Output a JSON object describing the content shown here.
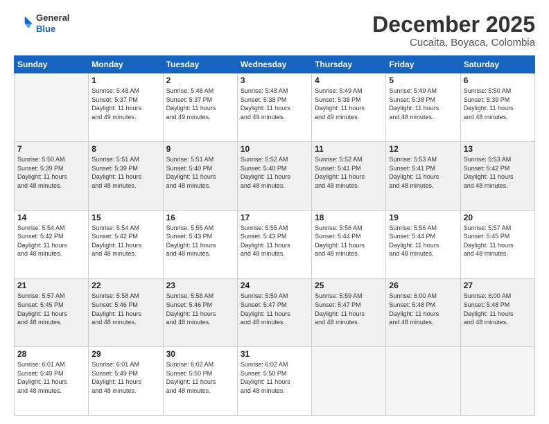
{
  "header": {
    "logo_line1": "General",
    "logo_line2": "Blue",
    "title": "December 2025",
    "subtitle": "Cucaita, Boyaca, Colombia"
  },
  "weekdays": [
    "Sunday",
    "Monday",
    "Tuesday",
    "Wednesday",
    "Thursday",
    "Friday",
    "Saturday"
  ],
  "weeks": [
    [
      {
        "day": "",
        "info": ""
      },
      {
        "day": "1",
        "info": "Sunrise: 5:48 AM\nSunset: 5:37 PM\nDaylight: 11 hours\nand 49 minutes."
      },
      {
        "day": "2",
        "info": "Sunrise: 5:48 AM\nSunset: 5:37 PM\nDaylight: 11 hours\nand 49 minutes."
      },
      {
        "day": "3",
        "info": "Sunrise: 5:48 AM\nSunset: 5:38 PM\nDaylight: 11 hours\nand 49 minutes."
      },
      {
        "day": "4",
        "info": "Sunrise: 5:49 AM\nSunset: 5:38 PM\nDaylight: 11 hours\nand 49 minutes."
      },
      {
        "day": "5",
        "info": "Sunrise: 5:49 AM\nSunset: 5:38 PM\nDaylight: 11 hours\nand 48 minutes."
      },
      {
        "day": "6",
        "info": "Sunrise: 5:50 AM\nSunset: 5:39 PM\nDaylight: 11 hours\nand 48 minutes."
      }
    ],
    [
      {
        "day": "7",
        "info": "Sunrise: 5:50 AM\nSunset: 5:39 PM\nDaylight: 11 hours\nand 48 minutes."
      },
      {
        "day": "8",
        "info": "Sunrise: 5:51 AM\nSunset: 5:39 PM\nDaylight: 11 hours\nand 48 minutes."
      },
      {
        "day": "9",
        "info": "Sunrise: 5:51 AM\nSunset: 5:40 PM\nDaylight: 11 hours\nand 48 minutes."
      },
      {
        "day": "10",
        "info": "Sunrise: 5:52 AM\nSunset: 5:40 PM\nDaylight: 11 hours\nand 48 minutes."
      },
      {
        "day": "11",
        "info": "Sunrise: 5:52 AM\nSunset: 5:41 PM\nDaylight: 11 hours\nand 48 minutes."
      },
      {
        "day": "12",
        "info": "Sunrise: 5:53 AM\nSunset: 5:41 PM\nDaylight: 11 hours\nand 48 minutes."
      },
      {
        "day": "13",
        "info": "Sunrise: 5:53 AM\nSunset: 5:42 PM\nDaylight: 11 hours\nand 48 minutes."
      }
    ],
    [
      {
        "day": "14",
        "info": "Sunrise: 5:54 AM\nSunset: 5:42 PM\nDaylight: 11 hours\nand 48 minutes."
      },
      {
        "day": "15",
        "info": "Sunrise: 5:54 AM\nSunset: 5:42 PM\nDaylight: 11 hours\nand 48 minutes."
      },
      {
        "day": "16",
        "info": "Sunrise: 5:55 AM\nSunset: 5:43 PM\nDaylight: 11 hours\nand 48 minutes."
      },
      {
        "day": "17",
        "info": "Sunrise: 5:55 AM\nSunset: 5:43 PM\nDaylight: 11 hours\nand 48 minutes."
      },
      {
        "day": "18",
        "info": "Sunrise: 5:56 AM\nSunset: 5:44 PM\nDaylight: 11 hours\nand 48 minutes."
      },
      {
        "day": "19",
        "info": "Sunrise: 5:56 AM\nSunset: 5:44 PM\nDaylight: 11 hours\nand 48 minutes."
      },
      {
        "day": "20",
        "info": "Sunrise: 5:57 AM\nSunset: 5:45 PM\nDaylight: 11 hours\nand 48 minutes."
      }
    ],
    [
      {
        "day": "21",
        "info": "Sunrise: 5:57 AM\nSunset: 5:45 PM\nDaylight: 11 hours\nand 48 minutes."
      },
      {
        "day": "22",
        "info": "Sunrise: 5:58 AM\nSunset: 5:46 PM\nDaylight: 11 hours\nand 48 minutes."
      },
      {
        "day": "23",
        "info": "Sunrise: 5:58 AM\nSunset: 5:46 PM\nDaylight: 11 hours\nand 48 minutes."
      },
      {
        "day": "24",
        "info": "Sunrise: 5:59 AM\nSunset: 5:47 PM\nDaylight: 11 hours\nand 48 minutes."
      },
      {
        "day": "25",
        "info": "Sunrise: 5:59 AM\nSunset: 5:47 PM\nDaylight: 11 hours\nand 48 minutes."
      },
      {
        "day": "26",
        "info": "Sunrise: 6:00 AM\nSunset: 5:48 PM\nDaylight: 11 hours\nand 48 minutes."
      },
      {
        "day": "27",
        "info": "Sunrise: 6:00 AM\nSunset: 5:48 PM\nDaylight: 11 hours\nand 48 minutes."
      }
    ],
    [
      {
        "day": "28",
        "info": "Sunrise: 6:01 AM\nSunset: 5:49 PM\nDaylight: 11 hours\nand 48 minutes."
      },
      {
        "day": "29",
        "info": "Sunrise: 6:01 AM\nSunset: 5:49 PM\nDaylight: 11 hours\nand 48 minutes."
      },
      {
        "day": "30",
        "info": "Sunrise: 6:02 AM\nSunset: 5:50 PM\nDaylight: 11 hours\nand 48 minutes."
      },
      {
        "day": "31",
        "info": "Sunrise: 6:02 AM\nSunset: 5:50 PM\nDaylight: 11 hours\nand 48 minutes."
      },
      {
        "day": "",
        "info": ""
      },
      {
        "day": "",
        "info": ""
      },
      {
        "day": "",
        "info": ""
      }
    ]
  ]
}
